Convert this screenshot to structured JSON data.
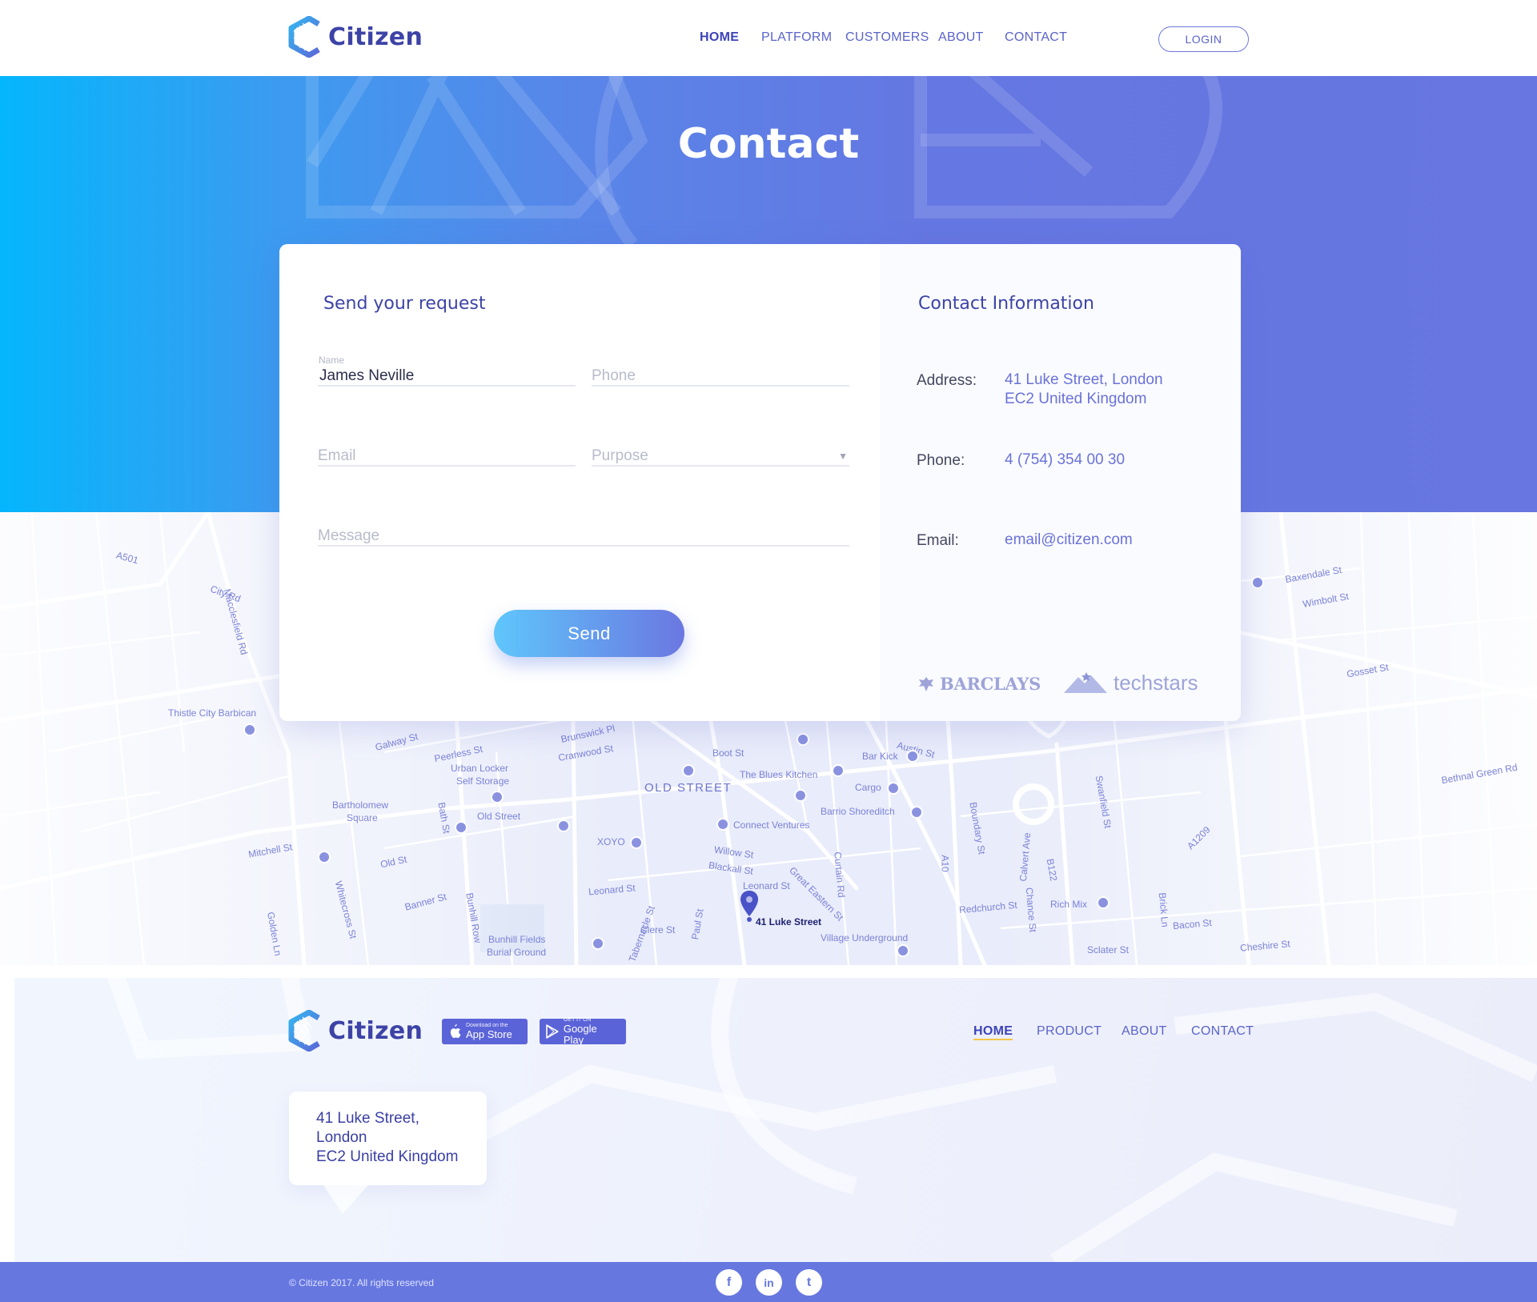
{
  "header": {
    "brand": "Citizen",
    "nav": [
      {
        "label": "HOME",
        "active": true
      },
      {
        "label": "PLATFORM",
        "active": false
      },
      {
        "label": "CUSTOMERS",
        "active": false
      },
      {
        "label": "ABOUT",
        "active": false
      },
      {
        "label": "CONTACT",
        "active": false
      }
    ],
    "login_label": "LOGIN"
  },
  "hero": {
    "title": "Contact"
  },
  "form": {
    "title": "Send your request",
    "name": {
      "label": "Name",
      "value": "James Neville"
    },
    "phone": {
      "placeholder": "Phone"
    },
    "email": {
      "placeholder": "Email"
    },
    "purpose": {
      "placeholder": "Purpose",
      "caret": "▼"
    },
    "message": {
      "placeholder": "Message"
    },
    "send_label": "Send"
  },
  "contact_info": {
    "title": "Contact Information",
    "address_label": "Address:",
    "address_line1": "41 Luke Street, London",
    "address_line2": "EC2 United Kingdom",
    "phone_label": "Phone:",
    "phone_value": "4 (754) 354 00 30",
    "email_label": "Email:",
    "email_value": "email@citizen.com",
    "partners": [
      "BARCLAYS",
      "techstars"
    ]
  },
  "map": {
    "pin_label": "41 Luke Street",
    "labels": [
      "A501",
      "City Rd",
      "Macclesfield Rd",
      "Thistle City Barbican",
      "Galway St",
      "Peerless St",
      "Brunswick Pl",
      "Cranwood St",
      "Urban Locker",
      "Self Storage",
      "OLD STREET",
      "Boot St",
      "The Blues Kitchen",
      "Bar Kick",
      "Cargo",
      "Barrio Shoreditch",
      "Connect Ventures",
      "Bartholomew",
      "Square",
      "Old Street",
      "XOYO",
      "Willow St",
      "Blackall St",
      "Leonard St",
      "Great Eastern St",
      "Mitchell St",
      "Old St",
      "Banner St",
      "Bunhill Row",
      "Bunhill Fields",
      "Burial Ground",
      "Tabernacle St",
      "Clere St",
      "Paul St",
      "Village Underground",
      "Curtain Rd",
      "Redchurch St",
      "Rich Mix",
      "Sclater St",
      "Bacon St",
      "Cheshire St",
      "Boundary St",
      "Austin St",
      "Swanfield St",
      "Calvert Ave",
      "Chance St",
      "Brick Ln",
      "B122",
      "A10",
      "A1209",
      "Baxendale St",
      "Wimbolt St",
      "Gosset St",
      "Bethnal Green Rd",
      "Whitecross St",
      "Golden Ln",
      "Bath St",
      "Leonard St"
    ]
  },
  "footer": {
    "brand": "Citizen",
    "appstore_small": "Download on the",
    "appstore_big": "App Store",
    "googleplay_small": "GET IT ON",
    "googleplay_big": "Google Play",
    "nav": [
      {
        "label": "HOME",
        "active": true
      },
      {
        "label": "PRODUCT",
        "active": false
      },
      {
        "label": "ABOUT",
        "active": false
      },
      {
        "label": "CONTACT",
        "active": false
      }
    ],
    "address_line1": "41 Luke Street,",
    "address_line2": "London",
    "address_line3": "EC2 United Kingdom"
  },
  "bottombar": {
    "copyright": "© Citizen 2017. All rights reserved",
    "social": [
      {
        "icon": "facebook-icon",
        "glyph": "f"
      },
      {
        "icon": "linkedin-icon",
        "glyph": "in"
      },
      {
        "icon": "twitter-icon",
        "glyph": "t"
      }
    ]
  },
  "colors": {
    "primary": "#6677e0",
    "accent_blue": "#04b6fc",
    "brand_text": "#3d43a6",
    "link": "#6a72d8"
  }
}
